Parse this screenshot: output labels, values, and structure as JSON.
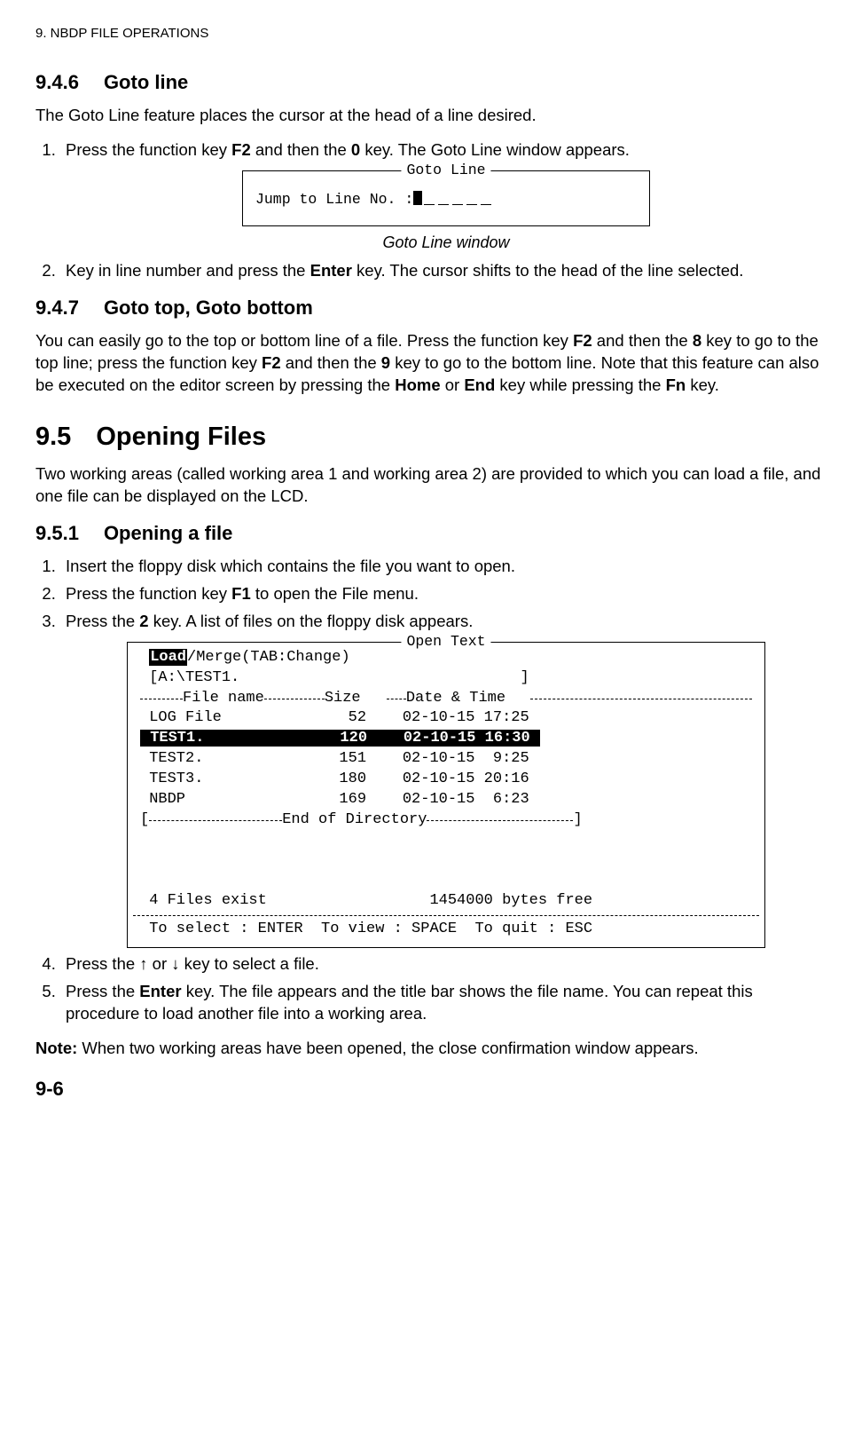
{
  "header": "9. NBDP FILE OPERATIONS",
  "s946": {
    "num": "9.4.6",
    "title": "Goto line",
    "p1_a": "The Goto Line feature places the cursor at the head of a line desired.",
    "li1_a": "Press the function key ",
    "li1_b": "F2",
    "li1_c": " and then the ",
    "li1_d": "0",
    "li1_e": " key. The Goto Line window appears.",
    "dlg_title": "Goto Line",
    "dlg_prompt": "Jump to Line No. :",
    "caption": "Goto Line window",
    "li2_a": "Key in line number and press the ",
    "li2_b": "Enter",
    "li2_c": " key. The cursor shifts to the head of the line selected."
  },
  "s947": {
    "num": "9.4.7",
    "title": "Goto top, Goto bottom",
    "p_a": "You can easily go to the top or bottom line of a file. Press the function key ",
    "p_b": "F2",
    "p_c": " and then the ",
    "p_d": "8",
    "p_e": " key to go to the top line; press the function key ",
    "p_f": "F2",
    "p_g": " and then the ",
    "p_h": "9",
    "p_i": " key to go to the bottom line. Note that this feature can also be executed on the editor screen by pressing the ",
    "p_j": "Home",
    "p_k": " or ",
    "p_l": "End",
    "p_m": " key while pressing the ",
    "p_n": "Fn",
    "p_o": " key."
  },
  "s95": {
    "num": "9.5",
    "title": "Opening Files",
    "p1": "Two working areas (called working area 1 and working area 2) are provided to which you can load a file, and one file can be displayed on the LCD."
  },
  "s951": {
    "num": "9.5.1",
    "title": "Opening a file",
    "li1": "Insert the floppy disk which contains the file you want to open.",
    "li2_a": "Press the function key ",
    "li2_b": "F1",
    "li2_c": " to open the File menu.",
    "li3_a": "Press the ",
    "li3_b": "2",
    "li3_c": " key. A list of files on the floppy disk appears.",
    "dlg_title": "Open Text",
    "mode_load": "Load",
    "mode_rest": "/Merge(TAB:Change)",
    "path_row": " [A:\\TEST1.                               ]",
    "hdr_name": "File name",
    "hdr_size": "Size",
    "hdr_dt": "Date & Time",
    "rows": [
      " LOG File              52    02-10-15 17:25",
      " TEST1.               120    02-10-15 16:30 ",
      " TEST2.               151    02-10-15  9:25",
      " TEST3.               180    02-10-15 20:16",
      " NBDP                 169    02-10-15  6:23"
    ],
    "eod_lb": " [",
    "eod_txt": "  End of Directory",
    "eod_rb": "   ]",
    "status": " 4 Files exist                  1454000 bytes free",
    "help": " To select : ENTER  To view : SPACE  To quit : ESC",
    "li4_a": "Press the ",
    "li4_b": "↑",
    "li4_c": " or ",
    "li4_d": "↓",
    "li4_e": " key to select a file.",
    "li5_a": "Press the ",
    "li5_b": "Enter",
    "li5_c": " key. The file appears and the title bar shows the file name. You can repeat this procedure to load another file into a working area."
  },
  "note_a": "Note:",
  "note_b": " When two working areas have been opened, the close confirmation window appears.",
  "page_num": "9-6"
}
